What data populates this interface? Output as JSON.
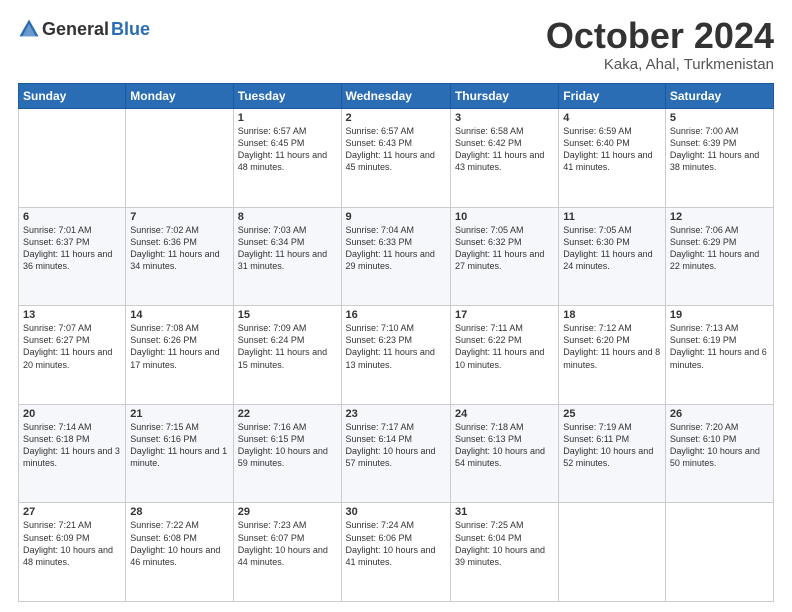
{
  "header": {
    "logo_general": "General",
    "logo_blue": "Blue",
    "month_title": "October 2024",
    "location": "Kaka, Ahal, Turkmenistan"
  },
  "days_of_week": [
    "Sunday",
    "Monday",
    "Tuesday",
    "Wednesday",
    "Thursday",
    "Friday",
    "Saturday"
  ],
  "weeks": [
    [
      {
        "day": "",
        "info": ""
      },
      {
        "day": "",
        "info": ""
      },
      {
        "day": "1",
        "info": "Sunrise: 6:57 AM\nSunset: 6:45 PM\nDaylight: 11 hours and 48 minutes."
      },
      {
        "day": "2",
        "info": "Sunrise: 6:57 AM\nSunset: 6:43 PM\nDaylight: 11 hours and 45 minutes."
      },
      {
        "day": "3",
        "info": "Sunrise: 6:58 AM\nSunset: 6:42 PM\nDaylight: 11 hours and 43 minutes."
      },
      {
        "day": "4",
        "info": "Sunrise: 6:59 AM\nSunset: 6:40 PM\nDaylight: 11 hours and 41 minutes."
      },
      {
        "day": "5",
        "info": "Sunrise: 7:00 AM\nSunset: 6:39 PM\nDaylight: 11 hours and 38 minutes."
      }
    ],
    [
      {
        "day": "6",
        "info": "Sunrise: 7:01 AM\nSunset: 6:37 PM\nDaylight: 11 hours and 36 minutes."
      },
      {
        "day": "7",
        "info": "Sunrise: 7:02 AM\nSunset: 6:36 PM\nDaylight: 11 hours and 34 minutes."
      },
      {
        "day": "8",
        "info": "Sunrise: 7:03 AM\nSunset: 6:34 PM\nDaylight: 11 hours and 31 minutes."
      },
      {
        "day": "9",
        "info": "Sunrise: 7:04 AM\nSunset: 6:33 PM\nDaylight: 11 hours and 29 minutes."
      },
      {
        "day": "10",
        "info": "Sunrise: 7:05 AM\nSunset: 6:32 PM\nDaylight: 11 hours and 27 minutes."
      },
      {
        "day": "11",
        "info": "Sunrise: 7:05 AM\nSunset: 6:30 PM\nDaylight: 11 hours and 24 minutes."
      },
      {
        "day": "12",
        "info": "Sunrise: 7:06 AM\nSunset: 6:29 PM\nDaylight: 11 hours and 22 minutes."
      }
    ],
    [
      {
        "day": "13",
        "info": "Sunrise: 7:07 AM\nSunset: 6:27 PM\nDaylight: 11 hours and 20 minutes."
      },
      {
        "day": "14",
        "info": "Sunrise: 7:08 AM\nSunset: 6:26 PM\nDaylight: 11 hours and 17 minutes."
      },
      {
        "day": "15",
        "info": "Sunrise: 7:09 AM\nSunset: 6:24 PM\nDaylight: 11 hours and 15 minutes."
      },
      {
        "day": "16",
        "info": "Sunrise: 7:10 AM\nSunset: 6:23 PM\nDaylight: 11 hours and 13 minutes."
      },
      {
        "day": "17",
        "info": "Sunrise: 7:11 AM\nSunset: 6:22 PM\nDaylight: 11 hours and 10 minutes."
      },
      {
        "day": "18",
        "info": "Sunrise: 7:12 AM\nSunset: 6:20 PM\nDaylight: 11 hours and 8 minutes."
      },
      {
        "day": "19",
        "info": "Sunrise: 7:13 AM\nSunset: 6:19 PM\nDaylight: 11 hours and 6 minutes."
      }
    ],
    [
      {
        "day": "20",
        "info": "Sunrise: 7:14 AM\nSunset: 6:18 PM\nDaylight: 11 hours and 3 minutes."
      },
      {
        "day": "21",
        "info": "Sunrise: 7:15 AM\nSunset: 6:16 PM\nDaylight: 11 hours and 1 minute."
      },
      {
        "day": "22",
        "info": "Sunrise: 7:16 AM\nSunset: 6:15 PM\nDaylight: 10 hours and 59 minutes."
      },
      {
        "day": "23",
        "info": "Sunrise: 7:17 AM\nSunset: 6:14 PM\nDaylight: 10 hours and 57 minutes."
      },
      {
        "day": "24",
        "info": "Sunrise: 7:18 AM\nSunset: 6:13 PM\nDaylight: 10 hours and 54 minutes."
      },
      {
        "day": "25",
        "info": "Sunrise: 7:19 AM\nSunset: 6:11 PM\nDaylight: 10 hours and 52 minutes."
      },
      {
        "day": "26",
        "info": "Sunrise: 7:20 AM\nSunset: 6:10 PM\nDaylight: 10 hours and 50 minutes."
      }
    ],
    [
      {
        "day": "27",
        "info": "Sunrise: 7:21 AM\nSunset: 6:09 PM\nDaylight: 10 hours and 48 minutes."
      },
      {
        "day": "28",
        "info": "Sunrise: 7:22 AM\nSunset: 6:08 PM\nDaylight: 10 hours and 46 minutes."
      },
      {
        "day": "29",
        "info": "Sunrise: 7:23 AM\nSunset: 6:07 PM\nDaylight: 10 hours and 44 minutes."
      },
      {
        "day": "30",
        "info": "Sunrise: 7:24 AM\nSunset: 6:06 PM\nDaylight: 10 hours and 41 minutes."
      },
      {
        "day": "31",
        "info": "Sunrise: 7:25 AM\nSunset: 6:04 PM\nDaylight: 10 hours and 39 minutes."
      },
      {
        "day": "",
        "info": ""
      },
      {
        "day": "",
        "info": ""
      }
    ]
  ]
}
